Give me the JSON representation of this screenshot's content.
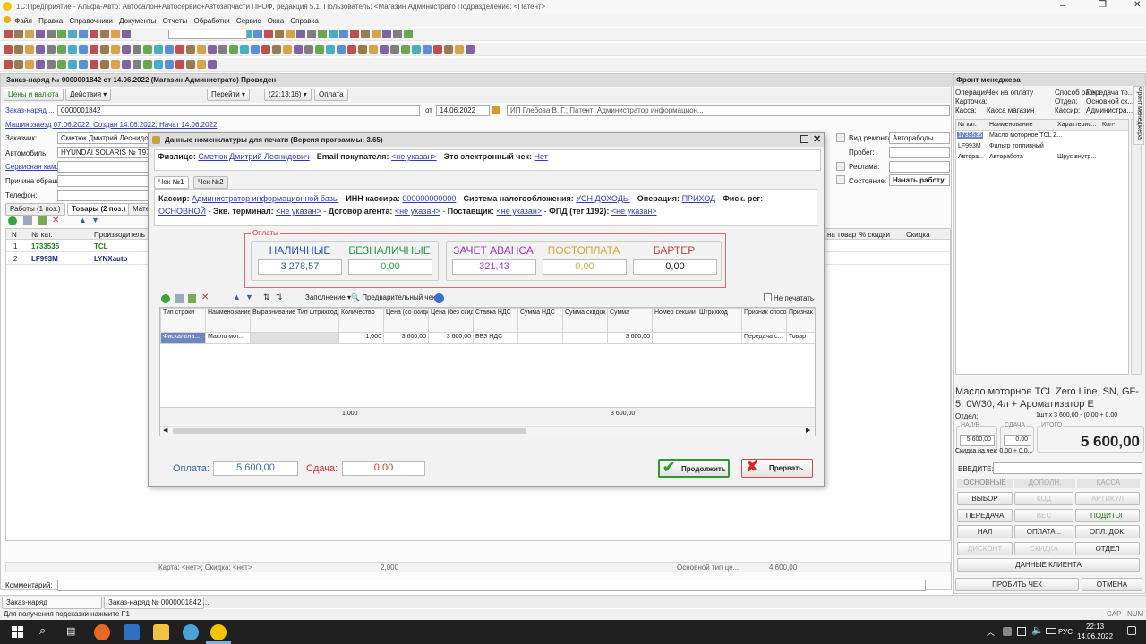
{
  "window": {
    "title": "1С:Предприятие - Альфа-Авто: Автосалон+Автосервис+Автозапчасти ПРОФ, редакция 5.1.  Пользователь: <Магазин Администрато  Подразделение: <Патент>"
  },
  "menu": [
    "Файл",
    "Правка",
    "Справочники",
    "Документы",
    "Отчеты",
    "Обработки",
    "Сервис",
    "Окна",
    "Справка"
  ],
  "doc": {
    "title": "Заказ-наряд № 0000001842 от 14.06.2022 (Магазин Администрато) Проведен",
    "toolbar": {
      "prices": "Цены и валюта",
      "actions": "Действия",
      "goto": "Перейти",
      "time": "(22:13:16)",
      "payment": "Оплата"
    },
    "number_label": "Заказ-наряд ...",
    "number": "0000001842",
    "date_label": "от",
    "date": "14.06.2022",
    "org": "ИП Глебова В. Г.; Патент; Администратор информацион...",
    "info_link": "Машинозаезд 07.06.2022; Создан 14.06.2022; Начат 14.06.2022",
    "customer_label": "Заказчик:",
    "customer": "Сметюк Дмитрий Леонидови",
    "car_label": "Автомобиль:",
    "car": "HYUNDAI SOLARIS № T974E",
    "service_label": "Сервисная кам...",
    "reason_label": "Причина обращ...",
    "phone_label": "Телефон:",
    "repair_type_label": "Вид ремонта:",
    "repair_type": "Авторабоды",
    "mileage_label": "Пробег:",
    "ad_label": "Реклама:",
    "state_label": "Состояние:",
    "state": "Начать работу",
    "tabs": [
      "Работы (1 поз.)",
      "Товары (2 поз.)",
      "Мате"
    ],
    "table": {
      "headers": [
        "N",
        "№ кат.",
        "Производитель"
      ],
      "right_headers": [
        "на товар",
        "% скидки",
        "Скидка"
      ],
      "rows": [
        {
          "n": "1",
          "cat": "1733535",
          "maker": "TCL"
        },
        {
          "n": "2",
          "cat": "LF993M",
          "maker": "LYNXauto"
        }
      ]
    },
    "footer": {
      "card": "Карта: <нет>; Скидка: <нет>",
      "qty": "2,000",
      "tax": "Основной тип це...",
      "sum": "4 600,00"
    },
    "comment_label": "Комментарий:"
  },
  "dialog": {
    "title": "Данные номенклатуры для печати (Версия программы: 3.65)",
    "person_label": "Физлицо:",
    "person": "Сметюк Дмитрий Леонидович",
    "email_label": "Email покупателя:",
    "email": "<не указан>",
    "echeck_label": "Это электронный чек:",
    "echeck": "Нет",
    "check_tabs": [
      "Чек №1",
      "Чек №2"
    ],
    "cashier_label": "Кассир:",
    "cashier": "Администратор информационной базы",
    "inn_label": "ИНН кассира:",
    "inn": "000000000000",
    "tax_label": "Система налогообложения:",
    "tax": "УСН ДОХОДЫ",
    "op_label": "Операция:",
    "op": "ПРИХОД",
    "fisc_label": "Фиск. рег:",
    "fisc": "ОСНОВНОЙ",
    "eq_label": "Экв. терминал:",
    "eq": "<не указан>",
    "agent_label": "Договор агента:",
    "agent": "<не указан>",
    "supplier_label": "Поставщик:",
    "supplier": "<не указан>",
    "fpd_label": "ФПД (тег 1192):",
    "fpd": "<не указан>",
    "payments_label": "Оплаты",
    "payments": [
      {
        "label": "НАЛИЧНЫЕ",
        "value": "3 278,57"
      },
      {
        "label": "БЕЗНАЛИЧНЫЕ",
        "value": "0,00"
      },
      {
        "label": "ЗАЧЕТ АВАНСА",
        "value": "321,43"
      },
      {
        "label": "ПОСТОПЛАТА",
        "value": "0,00"
      },
      {
        "label": "БАРТЕР",
        "value": "0,00"
      }
    ],
    "fill_label": "Заполнение",
    "preview_label": "Предварительный чек",
    "noprint_label": "Не печатать",
    "grid_headers": [
      "Тип строки",
      "Наименование",
      "Выравнивание",
      "Тип штрихкода",
      "Количество",
      "Цена (со скидками)",
      "Цена (без скидки)",
      "Ставка НДС",
      "Сумма НДС",
      "Сумма скидок",
      "Сумма",
      "Номер секции",
      "Штрихкод",
      "Признак способа ...",
      "Признак предмета"
    ],
    "grid_row": [
      "Фискальна...",
      "Масло мот...",
      "",
      "",
      "1,000",
      "3 600,00",
      "3 600,00",
      "БЕЗ НДС",
      "",
      "",
      "3 600,00",
      "",
      "",
      "Передача с...",
      "Товар"
    ],
    "grid_totals": {
      "qty": "1,000",
      "sum": "3 600,00"
    },
    "pay_label": "Оплата:",
    "pay_value": "5 600,00",
    "change_label": "Сдача:",
    "change_value": "0,00",
    "continue_label": "Продолжить",
    "cancel_label": "Прервать"
  },
  "front": {
    "title": "Фронт менеджера",
    "op_label": "Операция:",
    "op": "Чек на оплату",
    "card_label": "Карточка:",
    "kassa_label": "Касса:",
    "kassa": "Касса магазин",
    "paymethod_label": "Способ расч.:",
    "paymethod": "Передача то...",
    "dept_label": "Отдел:",
    "dept": "Основной ск...",
    "cashier_label": "Кассир:",
    "cashier": "Администра...",
    "headers": [
      "№ кат.",
      "Наименование",
      "Характерис...",
      "Кол-"
    ],
    "rows": [
      {
        "cat": "1733535",
        "name": "Масло моторное TCL Z...",
        "ch": ""
      },
      {
        "cat": "LF993M",
        "name": "Фильтр топливный",
        "ch": ""
      },
      {
        "cat": "Автора...",
        "name": "Авторабота",
        "ch": "Шрус внутр..."
      }
    ],
    "product": "Масло моторное TCL Zero Line, SN, GF-5, 0W30, 4л + Ароматизатор E",
    "otdel_label": "Отдел:",
    "qty_line": "1шт x 3 600,00 - (0.00 + 0.00",
    "napb_label": "НАЛ/Б",
    "napb": "5 600,00",
    "sdacha_label": "СДАЧА",
    "sdacha": "0.00",
    "itogo_label": "ИТОГО",
    "itogo": "5 600,00",
    "discount_line": "Скидка на чек: 0.00 + 0.0...",
    "enter_label": "ВВЕДИТЕ:",
    "tabs": [
      "ОСНОВНЫЕ",
      "ДОПОЛН.",
      "КАССА"
    ],
    "buttons": [
      "ВЫБОР",
      "КОД",
      "АРТИКУЛ",
      "ПЕРЕДАЧА",
      "ВЕС",
      "ПОДИТОГ",
      "НАЛ",
      "ОПЛАТА...",
      "ОПЛ. ДОК.",
      "ДИСКОНТ",
      "СКИДКА",
      "ОТДЕЛ"
    ],
    "client": "ДАННЫЕ КЛИЕНТА",
    "punch": "ПРОБИТЬ ЧЕК",
    "cancel": "ОТМЕНА",
    "side_tab": "Фронт менеджера"
  },
  "wintabs": [
    "Заказ-наряд",
    "Заказ-наряд № 0000001842 ..."
  ],
  "status": "Для получения подсказки нажмите F1",
  "indicators": [
    "CAP",
    "NUM"
  ],
  "taskbar": {
    "lang": "РУС",
    "time": "22:13",
    "date": "14.06.2022"
  }
}
